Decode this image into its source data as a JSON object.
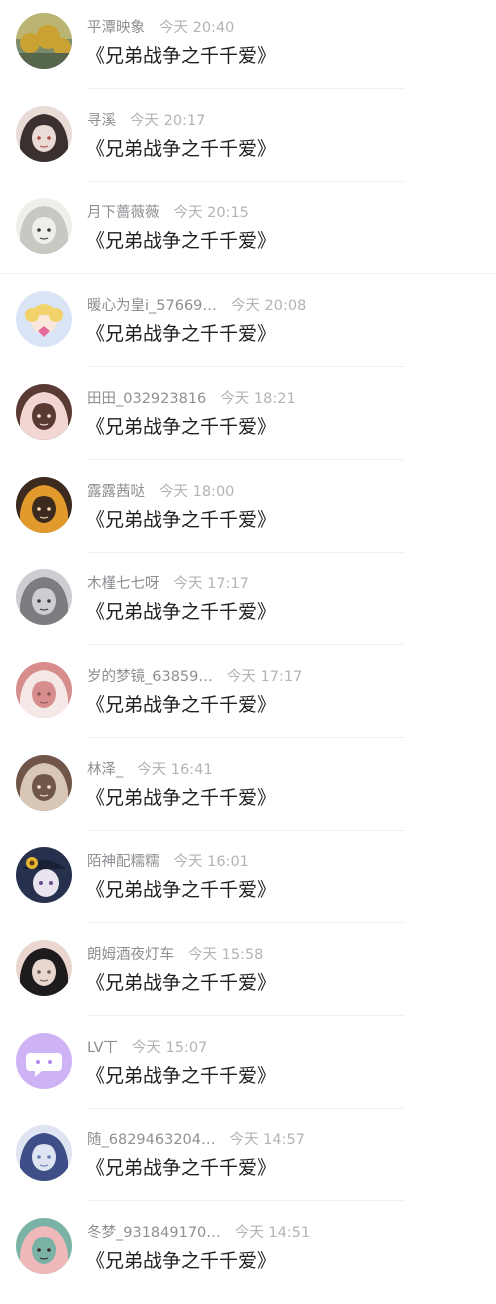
{
  "messages": [
    {
      "name": "平潭映象",
      "time": "今天 20:40",
      "text": "《兄弟战争之千千爱》",
      "avatar": "yellow-flowers-photo",
      "colors": [
        "#c9a233",
        "#7a8a6a",
        "#e6d27a"
      ]
    },
    {
      "name": "寻溪",
      "time": "今天 20:17",
      "text": "《兄弟战争之千千爱》",
      "avatar": "fox-girl-anime",
      "colors": [
        "#3a3030",
        "#e9dcd6",
        "#b94a4a"
      ]
    },
    {
      "name": "月下蔷薇薇",
      "time": "今天 20:15",
      "text": "《兄弟战争之千千爱》",
      "avatar": "sketch-girl-anime",
      "colors": [
        "#c8c8c2",
        "#efefe9",
        "#3b3b3b"
      ]
    },
    {
      "name": "暖心为皇i_57669…",
      "time": "今天 20:08",
      "text": "《兄弟战争之千千爱》",
      "avatar": "sailor-moon-pattern",
      "colors": [
        "#d9e4f6",
        "#f2d36b",
        "#e66b9a"
      ]
    },
    {
      "name": "田田_032923816",
      "time": "今天 18:21",
      "text": "《兄弟战争之千千爱》",
      "avatar": "girl-photo-pink",
      "colors": [
        "#f1d6d4",
        "#5b3a33",
        "#f7e6e1"
      ]
    },
    {
      "name": "露露茜哒",
      "time": "今天 18:00",
      "text": "《兄弟战争之千千爱》",
      "avatar": "orange-hair-anime",
      "colors": [
        "#e39a2d",
        "#3b2a1d",
        "#f7d7b0"
      ]
    },
    {
      "name": "木槿七七呀",
      "time": "今天 17:17",
      "text": "《兄弟战争之千千爱》",
      "avatar": "gray-hair-anime",
      "colors": [
        "#7d7a80",
        "#cfcdd2",
        "#3a3a40"
      ]
    },
    {
      "name": "岁的梦镜_63859…",
      "time": "今天 17:17",
      "text": "《兄弟战争之千千爱》",
      "avatar": "lineart-girl",
      "colors": [
        "#f4e9e6",
        "#d88d8d",
        "#8b5a5a"
      ]
    },
    {
      "name": "林泽_",
      "time": "今天 16:41",
      "text": "《兄弟战争之千千爱》",
      "avatar": "couple-illustration",
      "colors": [
        "#d8c7b6",
        "#6f5648",
        "#f0e6dc"
      ]
    },
    {
      "name": "陌神配糯糯",
      "time": "今天 16:01",
      "text": "《兄弟战争之千千爱》",
      "avatar": "sunflower-hat-anime",
      "colors": [
        "#27304d",
        "#e6b531",
        "#e9e4ef"
      ]
    },
    {
      "name": "朗姆酒夜灯车",
      "time": "今天 15:58",
      "text": "《兄弟战争之千千爱》",
      "avatar": "dark-hair-girl-photo",
      "colors": [
        "#1d1b1d",
        "#e9d7cf",
        "#6a5a58"
      ]
    },
    {
      "name": "LV丅",
      "time": "今天 15:07",
      "text": "《兄弟战争之千千爱》",
      "avatar": "chat-bubble-default",
      "colors": [
        "#cdb2f5",
        "#ffffff",
        "#b08ce8"
      ]
    },
    {
      "name": "随_6829463204…",
      "time": "今天 14:57",
      "text": "《兄弟战争之千千爱》",
      "avatar": "blue-hair-anime",
      "colors": [
        "#3e4e86",
        "#dfe4f2",
        "#6b7fb8"
      ]
    },
    {
      "name": "冬梦_931849170…",
      "time": "今天 14:51",
      "text": "《兄弟战争之千千爱》",
      "avatar": "floral-doll",
      "colors": [
        "#f0b8b8",
        "#7ab2a5",
        "#3a2a2a"
      ]
    }
  ]
}
